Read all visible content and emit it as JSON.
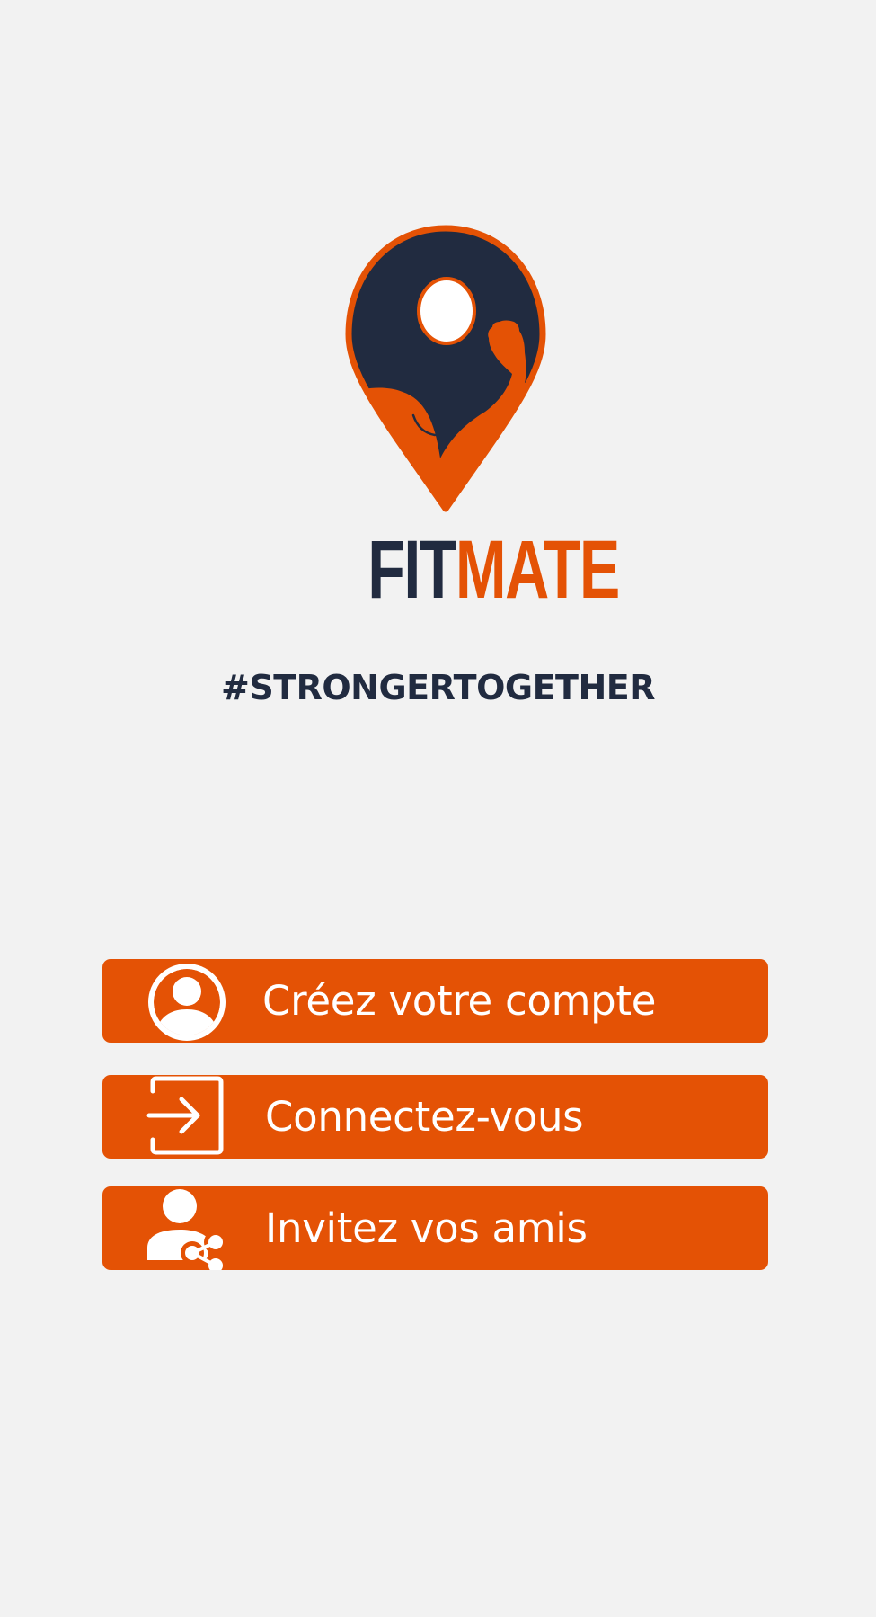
{
  "app": {
    "brand_part1": "FIT",
    "brand_part2": "MATE",
    "tagline": "#STRONGERTOGETHER"
  },
  "logo": {
    "icon": "location-pin-flexed-arm-icon"
  },
  "colors": {
    "background": "#f2f2f2",
    "accent": "#e45205",
    "navy": "#212b40",
    "button_text": "#ffffff"
  },
  "buttons": [
    {
      "label": "Créez votre compte",
      "icon": "user-account-icon"
    },
    {
      "label": "Connectez-vous",
      "icon": "sign-in-icon"
    },
    {
      "label": "Invitez vos amis",
      "icon": "user-share-icon"
    }
  ]
}
